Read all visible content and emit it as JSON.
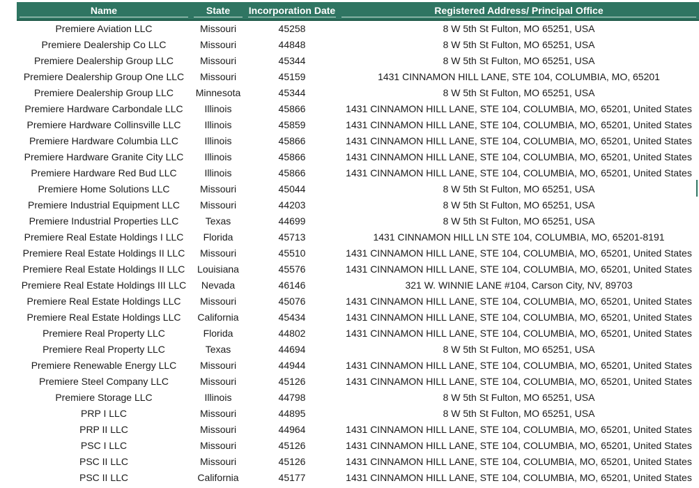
{
  "headers": {
    "name": "Name",
    "state": "State",
    "date": "Incorporation Date",
    "address": "Registered Address/ Principal Office"
  },
  "rows": [
    {
      "name": "Premiere Aviation LLC",
      "state": "Missouri",
      "date": "45258",
      "address": "8 W 5th St Fulton, MO 65251, USA"
    },
    {
      "name": "Premiere Dealership Co LLC",
      "state": "Missouri",
      "date": "44848",
      "address": "8 W 5th St Fulton, MO 65251, USA"
    },
    {
      "name": "Premiere Dealership Group LLC",
      "state": "Missouri",
      "date": "45344",
      "address": "8 W 5th St Fulton, MO 65251, USA"
    },
    {
      "name": "Premiere Dealership Group One LLC",
      "state": "Missouri",
      "date": "45159",
      "address": "1431 CINNAMON HILL LANE, STE 104, COLUMBIA, MO, 65201"
    },
    {
      "name": "Premiere Dealership Group LLC",
      "state": "Minnesota",
      "date": "45344",
      "address": "8 W 5th St Fulton, MO 65251, USA"
    },
    {
      "name": "Premiere Hardware Carbondale LLC",
      "state": "Illinois",
      "date": "45866",
      "address": "1431 CINNAMON HILL LANE, STE 104, COLUMBIA, MO, 65201, United States"
    },
    {
      "name": "Premiere Hardware Collinsville LLC",
      "state": "Illinois",
      "date": "45859",
      "address": "1431 CINNAMON HILL LANE, STE 104, COLUMBIA, MO, 65201, United States"
    },
    {
      "name": "Premiere Hardware Columbia LLC",
      "state": "Illinois",
      "date": "45866",
      "address": "1431 CINNAMON HILL LANE, STE 104, COLUMBIA, MO, 65201, United States"
    },
    {
      "name": "Premiere Hardware Granite City LLC",
      "state": "Illinois",
      "date": "45866",
      "address": "1431 CINNAMON HILL LANE, STE 104, COLUMBIA, MO, 65201, United States"
    },
    {
      "name": "Premiere Hardware Red Bud LLC",
      "state": "Illinois",
      "date": "45866",
      "address": "1431 CINNAMON HILL LANE, STE 104, COLUMBIA, MO, 65201, United States"
    },
    {
      "name": "Premiere Home Solutions LLC",
      "state": "Missouri",
      "date": "45044",
      "address": "8 W 5th St Fulton, MO 65251, USA"
    },
    {
      "name": "Premiere Industrial Equipment LLC",
      "state": "Missouri",
      "date": "44203",
      "address": "8 W 5th St Fulton, MO 65251, USA"
    },
    {
      "name": "Premiere Industrial Properties LLC",
      "state": "Texas",
      "date": "44699",
      "address": "8 W 5th St Fulton, MO 65251, USA"
    },
    {
      "name": "Premiere Real Estate Holdings I LLC",
      "state": "Florida",
      "date": "45713",
      "address": "1431 CINNAMON HILL LN STE 104, COLUMBIA, MO, 65201-8191"
    },
    {
      "name": "Premiere Real Estate Holdings II LLC",
      "state": "Missouri",
      "date": "45510",
      "address": "1431 CINNAMON HILL LANE, STE 104, COLUMBIA, MO, 65201, United States"
    },
    {
      "name": "Premiere Real Estate Holdings II LLC",
      "state": "Louisiana",
      "date": "45576",
      "address": "1431 CINNAMON HILL LANE, STE 104, COLUMBIA, MO, 65201, United States"
    },
    {
      "name": "Premiere Real Estate Holdings III LLC",
      "state": "Nevada",
      "date": "46146",
      "address": "321 W. WINNIE LANE #104, Carson City, NV, 89703"
    },
    {
      "name": "Premiere Real Estate Holdings LLC",
      "state": "Missouri",
      "date": "45076",
      "address": "1431 CINNAMON HILL LANE, STE 104, COLUMBIA, MO, 65201, United States"
    },
    {
      "name": "Premiere Real Estate Holdings LLC",
      "state": "California",
      "date": "45434",
      "address": "1431 CINNAMON HILL LANE, STE 104, COLUMBIA, MO, 65201, United States"
    },
    {
      "name": "Premiere Real Property LLC",
      "state": "Florida",
      "date": "44802",
      "address": "1431 CINNAMON HILL LANE, STE 104, COLUMBIA, MO, 65201, United States"
    },
    {
      "name": "Premiere Real Property LLC",
      "state": "Texas",
      "date": "44694",
      "address": "8 W 5th St Fulton, MO 65251, USA"
    },
    {
      "name": "Premiere Renewable Energy LLC",
      "state": "Missouri",
      "date": "44944",
      "address": "1431 CINNAMON HILL LANE, STE 104, COLUMBIA, MO, 65201, United States"
    },
    {
      "name": "Premiere Steel Company LLC",
      "state": "Missouri",
      "date": "45126",
      "address": "1431 CINNAMON HILL LANE, STE 104, COLUMBIA, MO, 65201, United States"
    },
    {
      "name": "Premiere Storage LLC",
      "state": "Illinois",
      "date": "44798",
      "address": "8 W 5th St Fulton, MO 65251, USA"
    },
    {
      "name": "PRP I LLC",
      "state": "Missouri",
      "date": "44895",
      "address": "8 W 5th St Fulton, MO 65251, USA"
    },
    {
      "name": "PRP II LLC",
      "state": "Missouri",
      "date": "44964",
      "address": "1431 CINNAMON HILL LANE, STE 104, COLUMBIA, MO, 65201, United States"
    },
    {
      "name": "PSC I LLC",
      "state": "Missouri",
      "date": "45126",
      "address": "1431 CINNAMON HILL LANE, STE 104, COLUMBIA, MO, 65201, United States"
    },
    {
      "name": "PSC II LLC",
      "state": "Missouri",
      "date": "45126",
      "address": "1431 CINNAMON HILL LANE, STE 104, COLUMBIA, MO, 65201, United States"
    },
    {
      "name": "PSC II LLC",
      "state": "California",
      "date": "45177",
      "address": "1431 CINNAMON HILL LANE, STE 104, COLUMBIA, MO, 65201, United States"
    }
  ],
  "colors": {
    "header_bg": "#2f7562",
    "header_text": "#ffffff",
    "cell_text": "#1a1a1a"
  }
}
